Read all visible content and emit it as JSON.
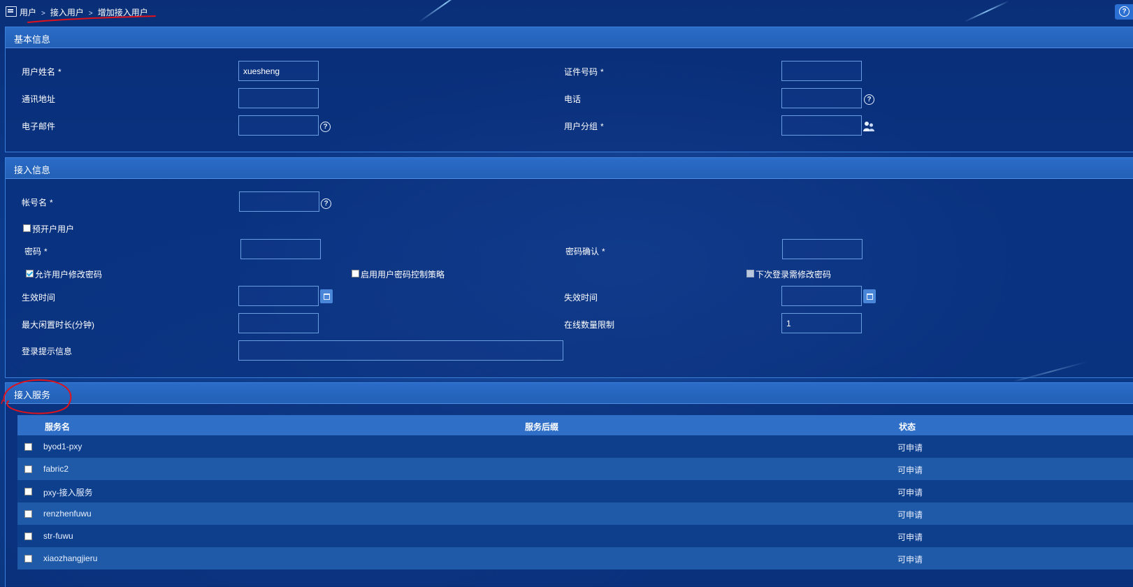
{
  "breadcrumb": {
    "items": [
      "用户",
      "接入用户",
      "增加接入用户"
    ],
    "separator": ">"
  },
  "basic_info": {
    "title": "基本信息",
    "user_name_label": "用户姓名",
    "user_name_value": "xuesheng",
    "id_number_label": "证件号码",
    "address_label": "通讯地址",
    "phone_label": "电话",
    "email_label": "电子邮件",
    "user_group_label": "用户分组",
    "required_mark": "*"
  },
  "access_info": {
    "title": "接入信息",
    "account_label": "帐号名",
    "pre_open_label": "预开户用户",
    "password_label": "密码",
    "password_confirm_label": "密码确认",
    "allow_change_label": "允许用户修改密码",
    "enable_policy_label": "启用用户密码控制策略",
    "next_login_label": "下次登录需修改密码",
    "effective_time_label": "生效时间",
    "expire_time_label": "失效时间",
    "max_idle_label": "最大闲置时长(分钟)",
    "online_limit_label": "在线数量限制",
    "online_limit_value": "1",
    "login_hint_label": "登录提示信息"
  },
  "access_service": {
    "title": "接入服务",
    "columns": [
      "服务名",
      "服务后缀",
      "状态"
    ],
    "rows": [
      {
        "name": "byod1-pxy",
        "suffix": "",
        "status": "可申请"
      },
      {
        "name": "fabric2",
        "suffix": "",
        "status": "可申请"
      },
      {
        "name": "pxy-接入服务",
        "suffix": "",
        "status": "可申请"
      },
      {
        "name": "renzhenfuwu",
        "suffix": "",
        "status": "可申请"
      },
      {
        "name": "str-fuwu",
        "suffix": "",
        "status": "可申请"
      },
      {
        "name": "xiaozhangjieru",
        "suffix": "",
        "status": "可申请"
      }
    ]
  },
  "icons": {
    "help": "question-circle-icon",
    "calendar": "calendar-icon",
    "group": "user-group-icon",
    "breadcrumb": "user-admin-icon"
  },
  "colors": {
    "background": "#0b3a8c",
    "panel_header": "#2b6cc8",
    "table_header": "#2f6fc7",
    "row_odd": "#0d3f8d",
    "row_even": "#1f5aa8",
    "annotation": "#e0121b"
  }
}
